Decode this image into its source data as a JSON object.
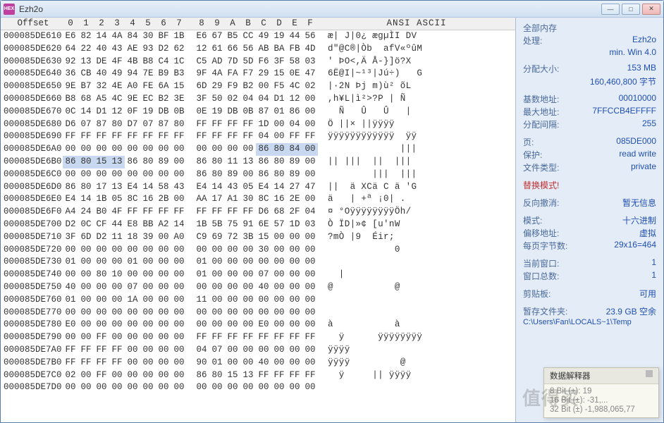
{
  "title": "Ezh2o",
  "app_icon_label": "HEX",
  "window_buttons": {
    "min": "—",
    "max": "□",
    "close": "✕"
  },
  "header": {
    "offset": "Offset",
    "cols": [
      "0",
      "1",
      "2",
      "3",
      "4",
      "5",
      "6",
      "7",
      "8",
      "9",
      "A",
      "B",
      "C",
      "D",
      "E",
      "F"
    ],
    "ansi": "ANSI ASCII"
  },
  "rows": [
    {
      "o": "000085DE610",
      "b": [
        "E6",
        "82",
        "14",
        "4A",
        "84",
        "30",
        "BF",
        "1B",
        "E6",
        "67",
        "B5",
        "CC",
        "49",
        "19",
        "44",
        "56"
      ],
      "a": "æ| J|0¿ ægµÌI DV"
    },
    {
      "o": "000085DE620",
      "b": [
        "64",
        "22",
        "40",
        "43",
        "AE",
        "93",
        "D2",
        "62",
        "12",
        "61",
        "66",
        "56",
        "AB",
        "BA",
        "FB",
        "4D"
      ],
      "a": "d\"@C®|Òb  afV«ºûM"
    },
    {
      "o": "000085DE630",
      "b": [
        "92",
        "13",
        "DE",
        "4F",
        "4B",
        "B8",
        "C4",
        "1C",
        "C5",
        "AD",
        "7D",
        "5D",
        "F6",
        "3F",
        "58",
        "03"
      ],
      "a": "' ÞO<,Ä Å-}]ö?X"
    },
    {
      "o": "000085DE640",
      "b": [
        "36",
        "CB",
        "40",
        "49",
        "94",
        "7E",
        "B9",
        "B3",
        "9F",
        "4A",
        "FA",
        "F7",
        "29",
        "15",
        "0E",
        "47"
      ],
      "a": "6Ë@I|~¹³|Jú÷)   G"
    },
    {
      "o": "000085DE650",
      "b": [
        "9E",
        "B7",
        "32",
        "4E",
        "A0",
        "FE",
        "6A",
        "15",
        "6D",
        "29",
        "F9",
        "B2",
        "00",
        "F5",
        "4C",
        "02"
      ],
      "a": "|·2N Þj m)ù² õL"
    },
    {
      "o": "000085DE660",
      "b": [
        "B8",
        "68",
        "A5",
        "4C",
        "9E",
        "EC",
        "B2",
        "3E",
        "3F",
        "50",
        "02",
        "04",
        "04",
        "D1",
        "12",
        "00"
      ],
      "a": ",h¥L|ì²>?P | Ñ"
    },
    {
      "o": "000085DE670",
      "b": [
        "0C",
        "14",
        "D1",
        "12",
        "0F",
        "19",
        "DB",
        "0B",
        "0E",
        "19",
        "DB",
        "0B",
        "87",
        "01",
        "86",
        "00"
      ],
      "a": "  Ñ   Û   Û   |"
    },
    {
      "o": "000085DE680",
      "b": [
        "D6",
        "07",
        "87",
        "80",
        "D7",
        "07",
        "87",
        "80",
        "FF",
        "FF",
        "FF",
        "FF",
        "1D",
        "00",
        "04",
        "00"
      ],
      "a": "Ö ||× ||ÿÿÿÿ"
    },
    {
      "o": "000085DE690",
      "b": [
        "FF",
        "FF",
        "FF",
        "FF",
        "FF",
        "FF",
        "FF",
        "FF",
        "FF",
        "FF",
        "FF",
        "FF",
        "04",
        "00",
        "FF",
        "FF"
      ],
      "a": "ÿÿÿÿÿÿÿÿÿÿÿÿ  ÿÿ"
    },
    {
      "o": "000085DE6A0",
      "b": [
        "00",
        "00",
        "00",
        "00",
        "00",
        "00",
        "00",
        "00",
        "00",
        "00",
        "00",
        "00",
        "86",
        "80",
        "84",
        "00"
      ],
      "a": "             |||",
      "sel": [
        12,
        13,
        14,
        15
      ]
    },
    {
      "o": "000085DE6B0",
      "b": [
        "86",
        "80",
        "15",
        "13",
        "86",
        "80",
        "89",
        "00",
        "86",
        "80",
        "11",
        "13",
        "86",
        "80",
        "89",
        "00"
      ],
      "a": "|| |||  ||  |||",
      "sel": [
        0,
        1,
        2,
        3
      ]
    },
    {
      "o": "000085DE6C0",
      "b": [
        "00",
        "00",
        "00",
        "00",
        "00",
        "00",
        "00",
        "00",
        "86",
        "80",
        "89",
        "00",
        "86",
        "80",
        "89",
        "00"
      ],
      "a": "        |||  |||"
    },
    {
      "o": "000085DE6D0",
      "b": [
        "86",
        "80",
        "17",
        "13",
        "E4",
        "14",
        "58",
        "43",
        "E4",
        "14",
        "43",
        "05",
        "E4",
        "14",
        "27",
        "47"
      ],
      "a": "||  ä XCä C ä 'G"
    },
    {
      "o": "000085DE6E0",
      "b": [
        "E4",
        "14",
        "1B",
        "05",
        "8C",
        "16",
        "2B",
        "00",
        "AA",
        "17",
        "A1",
        "30",
        "8C",
        "16",
        "2E",
        "00"
      ],
      "a": "ä   | +ª ¡0| ."
    },
    {
      "o": "000085DE6F0",
      "b": [
        "A4",
        "24",
        "B0",
        "4F",
        "FF",
        "FF",
        "FF",
        "FF",
        "FF",
        "FF",
        "FF",
        "FF",
        "D6",
        "68",
        "2F",
        "04"
      ],
      "a": "¤ °OÿÿÿÿÿÿÿÿÖh/"
    },
    {
      "o": "000085DE700",
      "b": [
        "D2",
        "0C",
        "CF",
        "44",
        "E8",
        "BB",
        "A2",
        "14",
        "1B",
        "5B",
        "75",
        "91",
        "6E",
        "57",
        "1D",
        "03"
      ],
      "a": "Ò ÏD|»¢ [u'nW"
    },
    {
      "o": "000085DE710",
      "b": [
        "3F",
        "6D",
        "D2",
        "11",
        "18",
        "39",
        "00",
        "A0",
        "C9",
        "69",
        "72",
        "3B",
        "15",
        "00",
        "00",
        "00"
      ],
      "a": "?mÒ |9  Éir;"
    },
    {
      "o": "000085DE720",
      "b": [
        "00",
        "00",
        "00",
        "00",
        "00",
        "00",
        "00",
        "00",
        "00",
        "00",
        "00",
        "00",
        "30",
        "00",
        "00",
        "00"
      ],
      "a": "            0"
    },
    {
      "o": "000085DE730",
      "b": [
        "01",
        "00",
        "00",
        "00",
        "01",
        "00",
        "00",
        "00",
        "01",
        "00",
        "00",
        "00",
        "00",
        "00",
        "00",
        "00"
      ],
      "a": ""
    },
    {
      "o": "000085DE740",
      "b": [
        "00",
        "00",
        "80",
        "10",
        "00",
        "00",
        "00",
        "00",
        "01",
        "00",
        "00",
        "00",
        "07",
        "00",
        "00",
        "00"
      ],
      "a": "  |"
    },
    {
      "o": "000085DE750",
      "b": [
        "40",
        "00",
        "00",
        "00",
        "07",
        "00",
        "00",
        "00",
        "00",
        "00",
        "00",
        "00",
        "40",
        "00",
        "00",
        "00"
      ],
      "a": "@           @"
    },
    {
      "o": "000085DE760",
      "b": [
        "01",
        "00",
        "00",
        "00",
        "1A",
        "00",
        "00",
        "00",
        "11",
        "00",
        "00",
        "00",
        "00",
        "00",
        "00",
        "00"
      ],
      "a": ""
    },
    {
      "o": "000085DE770",
      "b": [
        "00",
        "00",
        "00",
        "00",
        "00",
        "00",
        "00",
        "00",
        "00",
        "00",
        "00",
        "00",
        "00",
        "00",
        "00",
        "00"
      ],
      "a": ""
    },
    {
      "o": "000085DE780",
      "b": [
        "E0",
        "00",
        "00",
        "00",
        "00",
        "00",
        "00",
        "00",
        "00",
        "00",
        "00",
        "00",
        "E0",
        "00",
        "00",
        "00"
      ],
      "a": "à           à"
    },
    {
      "o": "000085DE790",
      "b": [
        "00",
        "00",
        "FF",
        "00",
        "00",
        "00",
        "00",
        "00",
        "FF",
        "FF",
        "FF",
        "FF",
        "FF",
        "FF",
        "FF",
        "FF"
      ],
      "a": "  ÿ      ÿÿÿÿÿÿÿÿ"
    },
    {
      "o": "000085DE7A0",
      "b": [
        "FF",
        "FF",
        "FF",
        "FF",
        "00",
        "00",
        "00",
        "00",
        "04",
        "07",
        "00",
        "00",
        "00",
        "00",
        "00",
        "00"
      ],
      "a": "ÿÿÿÿ"
    },
    {
      "o": "000085DE7B0",
      "b": [
        "FF",
        "FF",
        "FF",
        "FF",
        "00",
        "00",
        "00",
        "00",
        "90",
        "01",
        "00",
        "00",
        "40",
        "00",
        "00",
        "00"
      ],
      "a": "ÿÿÿÿ         @"
    },
    {
      "o": "000085DE7C0",
      "b": [
        "02",
        "00",
        "FF",
        "00",
        "00",
        "00",
        "00",
        "00",
        "86",
        "80",
        "15",
        "13",
        "FF",
        "FF",
        "FF",
        "FF"
      ],
      "a": "  ÿ     || ÿÿÿÿ"
    },
    {
      "o": "000085DE7D0",
      "b": [
        "00",
        "00",
        "00",
        "00",
        "00",
        "00",
        "00",
        "00",
        "00",
        "00",
        "00",
        "00",
        "00",
        "00",
        "00",
        "00"
      ],
      "a": ""
    }
  ],
  "side": {
    "mem_title": "全部内存",
    "proc_label": "处理:",
    "proc_value": "Ezh2o",
    "proc_sub": "min. Win 4.0",
    "alloc_label": "分配大小:",
    "alloc_value": "153 MB",
    "alloc_bytes": "160,460,800 字节",
    "base_label": "基数地址:",
    "base_value": "00010000",
    "max_label": "最大地址:",
    "max_value": "7FFCCB4EFFFF",
    "gap_label": "分配间隔:",
    "gap_value": "255",
    "page_label": "页:",
    "page_value": "085DE000",
    "prot_label": "保护:",
    "prot_value": "read write",
    "type_label": "文件类型:",
    "type_value": "private",
    "replace_label": "替换模式!",
    "undo_label": "反向撤消:",
    "undo_value": "暂无信息",
    "mode_label": "模式:",
    "mode_value": "十六进制",
    "offaddr_label": "偏移地址:",
    "offaddr_value": "虚拟",
    "bpr_label": "每页字节数:",
    "bpr_value": "29x16=464",
    "curwin_label": "当前窗口:",
    "curwin_value": "1",
    "totwin_label": "窗口总数:",
    "totwin_value": "1",
    "clip_label": "剪贴板:",
    "clip_value": "可用",
    "tmp_label": "暂存文件夹:",
    "tmp_value": "23.9 GB 空余",
    "tmp_path": "C:\\Users\\Fan\\LOCALS~1\\Temp"
  },
  "tooltip": {
    "title": "数据解释器",
    "r1": "8 Bit (±): 19",
    "r2": "16 Bit (±): -31,...",
    "r3": "32 Bit (±) -1,988,065,77"
  },
  "watermark": "值得买"
}
